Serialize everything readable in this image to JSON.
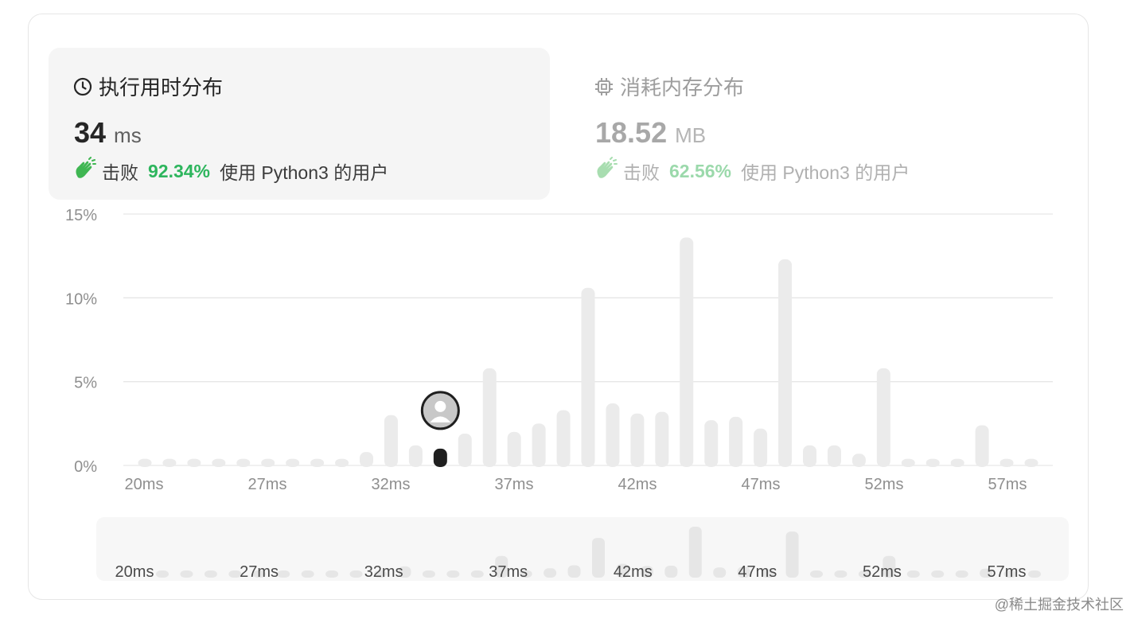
{
  "runtime_panel": {
    "title": "执行用时分布",
    "value": "34",
    "unit": "ms",
    "beats_prefix": "击败",
    "beats_pct": "92.34%",
    "beats_suffix": "使用 Python3 的用户",
    "icon": "clock-icon"
  },
  "memory_panel": {
    "title": "消耗内存分布",
    "value": "18.52",
    "unit": "MB",
    "beats_prefix": "击败",
    "beats_pct": "62.56%",
    "beats_suffix": "使用 Python3 的用户",
    "icon": "chip-icon"
  },
  "colors": {
    "bar": "#ebebeb",
    "highlight_bar": "#1f1f1f",
    "grid": "#e6e6e6",
    "beats_green": "#2db55d",
    "axis_text": "#8f8f8f"
  },
  "chart_data": {
    "type": "bar",
    "x_labels": [
      "20ms",
      "27ms",
      "32ms",
      "37ms",
      "42ms",
      "47ms",
      "52ms",
      "57ms"
    ],
    "y_ticks": [
      "0%",
      "5%",
      "10%",
      "15%"
    ],
    "ylim": [
      0,
      15
    ],
    "values": [
      0.4,
      0.4,
      0.4,
      0.4,
      0.4,
      0.4,
      0.4,
      0.4,
      0.4,
      0.8,
      3.0,
      1.2,
      1.0,
      1.9,
      5.8,
      2.0,
      2.5,
      3.3,
      10.6,
      3.7,
      3.1,
      3.2,
      13.6,
      2.7,
      2.9,
      2.2,
      12.3,
      1.2,
      1.2,
      0.7,
      5.8,
      0.4,
      0.4,
      0.4,
      2.4,
      0.4,
      0.4
    ],
    "highlight_index": 12,
    "grid": true,
    "minimap_x_labels": [
      "20ms",
      "27ms",
      "32ms",
      "37ms",
      "42ms",
      "47ms",
      "52ms",
      "57ms"
    ]
  },
  "watermark": "@稀土掘金技术社区"
}
